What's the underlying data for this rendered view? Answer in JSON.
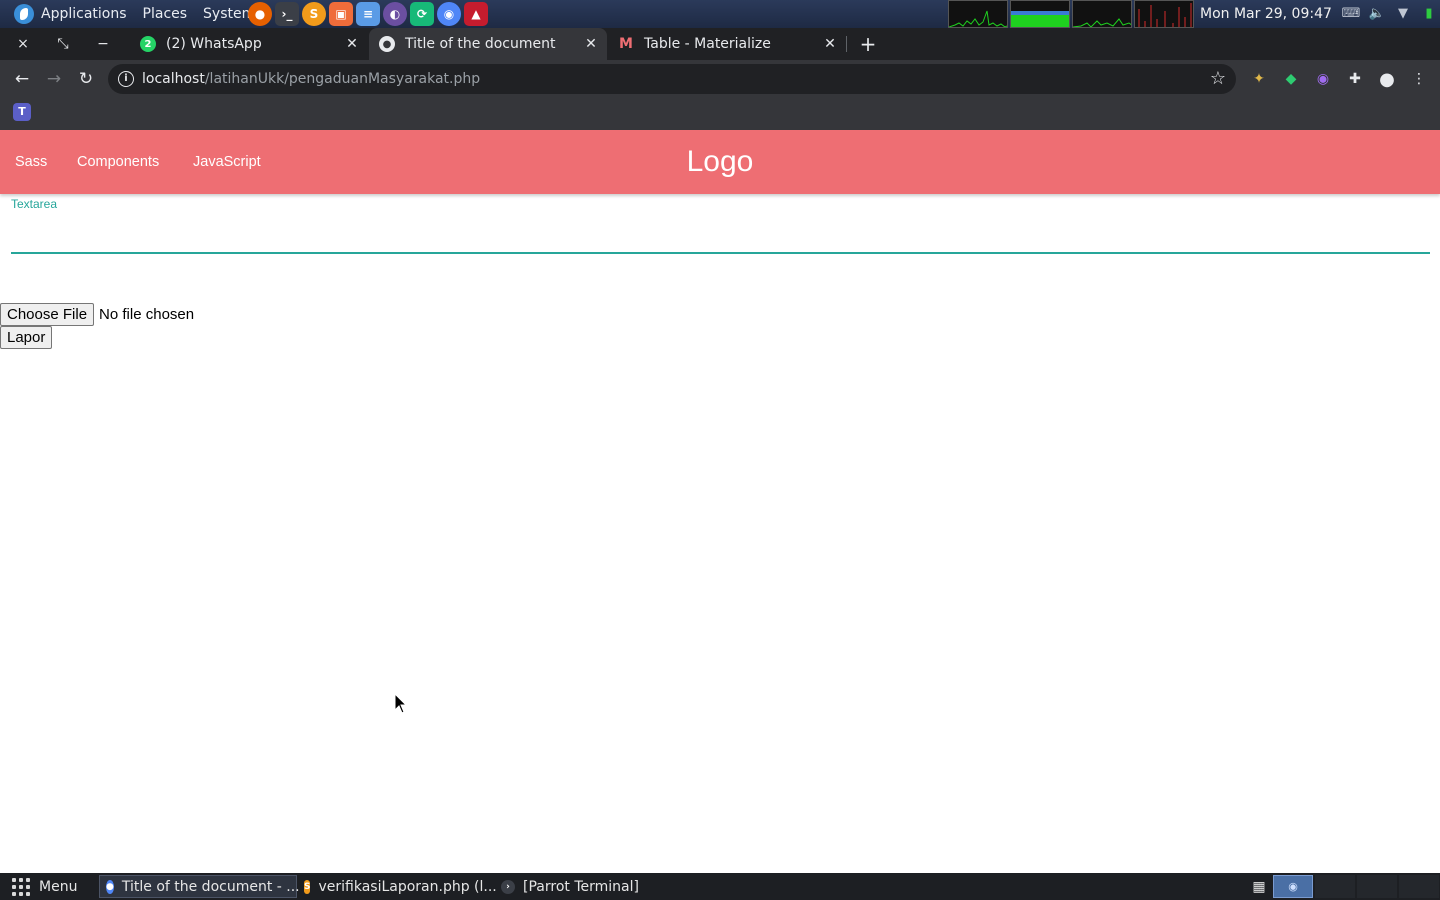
{
  "system_panel": {
    "menus": [
      "Applications",
      "Places",
      "System"
    ],
    "launchers": [
      {
        "icon": "firefox-icon",
        "color": "#e66000"
      },
      {
        "icon": "terminal-icon",
        "color": "#3b3f47"
      },
      {
        "icon": "sublime-text-icon",
        "color": "#f29b1b"
      },
      {
        "icon": "package-icon",
        "color": "#ef6c3a"
      },
      {
        "icon": "text-editor-icon",
        "color": "#5a9be6"
      },
      {
        "icon": "tor-icon",
        "color": "#6b4fa1"
      },
      {
        "icon": "sync-icon",
        "color": "#17b978"
      },
      {
        "icon": "chromium-icon",
        "color": "#4f86f7"
      },
      {
        "icon": "app-icon",
        "color": "#c61c2e"
      }
    ],
    "clock": "Mon Mar 29, 09:47",
    "tray_icons": [
      "keyboard-icon",
      "volume-icon",
      "wifi-icon",
      "battery-icon"
    ]
  },
  "browser": {
    "window_controls": {
      "close": "×",
      "maximize": "⤡",
      "minimize": "−"
    },
    "tabs": [
      {
        "title": "(2) WhatsApp",
        "favicon": "whatsapp-icon",
        "favicon_color": "#25d366",
        "badge": "2",
        "active": false
      },
      {
        "title": "Title of the document",
        "favicon": "globe-icon",
        "favicon_color": "#e8eaed",
        "active": true
      },
      {
        "title": "Table - Materialize",
        "favicon": "materialize-icon",
        "favicon_color": "#ee6e73",
        "active": false
      }
    ],
    "new_tab": "+",
    "url_host": "localhost",
    "url_path": "/latihanUkk/pengaduanMasyarakat.php",
    "extensions": [
      "extension-icon-1",
      "extension-icon-2",
      "extension-icon-3",
      "puzzle-icon",
      "profile-icon",
      "more-icon"
    ],
    "bookmark": "teams-icon"
  },
  "page": {
    "nav_links": [
      "Sass",
      "Components",
      "JavaScript"
    ],
    "brand": "Logo",
    "brand_color": "#ee6e73",
    "accent_color": "#26a69a",
    "textarea_label": "Textarea",
    "textarea_value": "",
    "file_button": "Choose File",
    "file_status": "No file chosen",
    "submit_button": "Lapor"
  },
  "taskbar": {
    "menu_label": "Menu",
    "tasks": [
      {
        "title": "Title of the document - ...",
        "icon": "chromium-icon",
        "color": "#4f86f7",
        "active": true
      },
      {
        "title": "verifikasiLaporan.php (l...",
        "icon": "sublime-text-icon",
        "color": "#f29b1b",
        "active": false
      },
      {
        "title": "[Parrot Terminal]",
        "icon": "terminal-icon",
        "color": "#3b3f47",
        "active": false
      }
    ]
  }
}
